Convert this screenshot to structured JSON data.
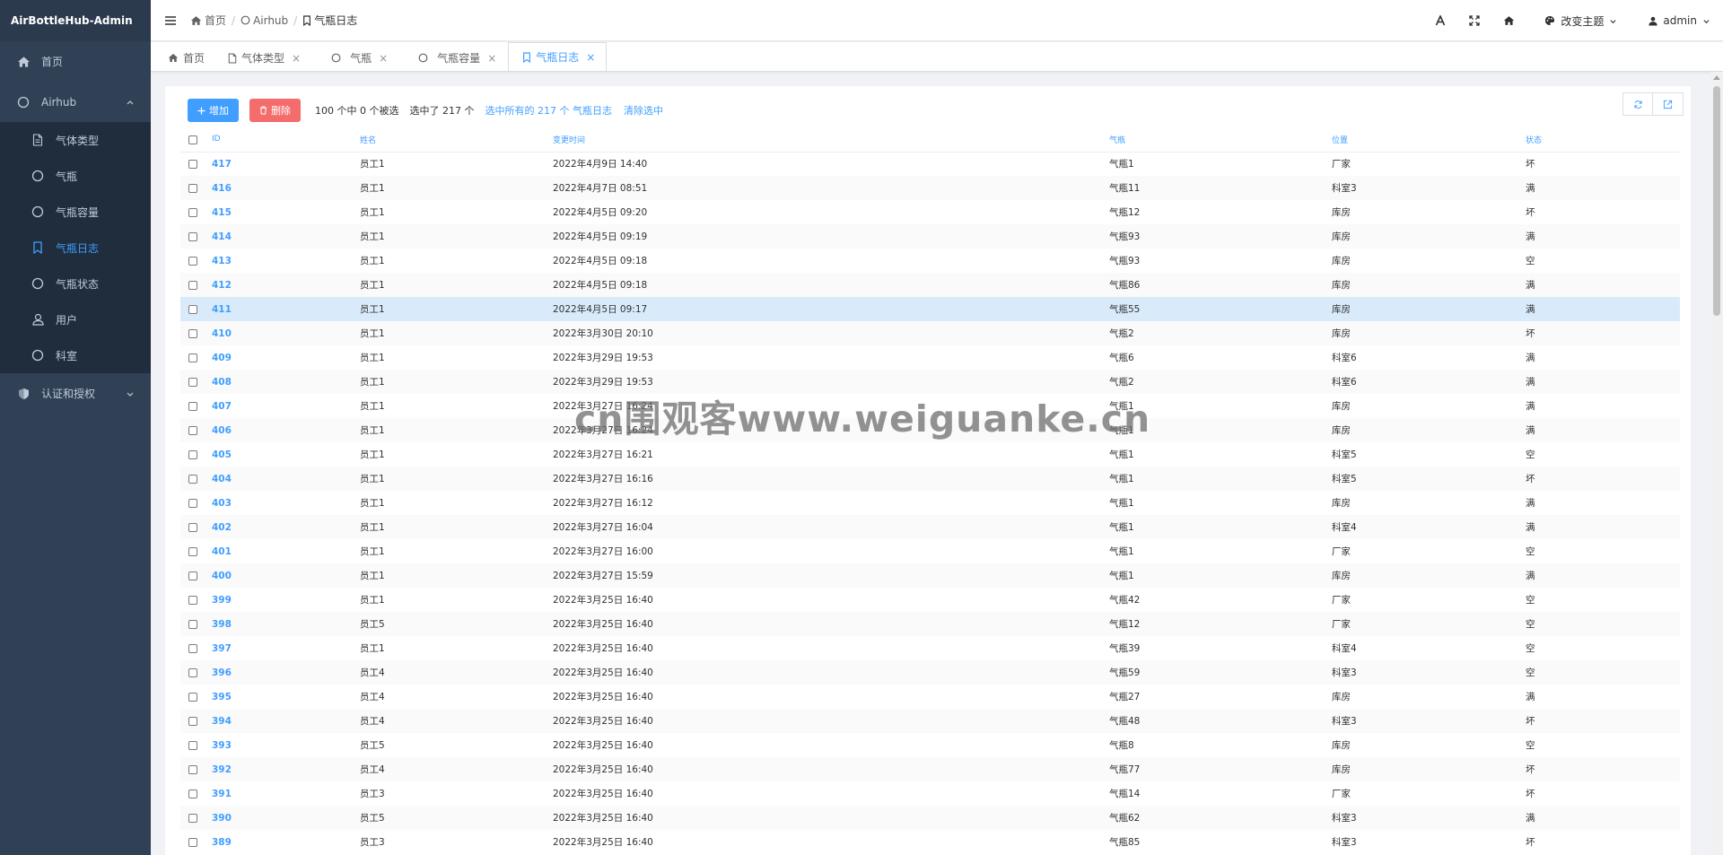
{
  "app": {
    "title": "AirBottleHub-Admin"
  },
  "sidebar": {
    "home": {
      "label": "首页",
      "icon": "home-icon"
    },
    "airhub": {
      "label": "Airhub",
      "icon": "circle-icon",
      "items": [
        {
          "label": "气体类型",
          "icon": "document-icon"
        },
        {
          "label": "气瓶",
          "icon": "circle-icon"
        },
        {
          "label": "气瓶容量",
          "icon": "circle-icon"
        },
        {
          "label": "气瓶日志",
          "icon": "bookmark-icon",
          "active": true
        },
        {
          "label": "气瓶状态",
          "icon": "circle-icon"
        },
        {
          "label": "用户",
          "icon": "user-icon"
        },
        {
          "label": "科室",
          "icon": "circle-icon"
        }
      ]
    },
    "auth": {
      "label": "认证和授权",
      "icon": "shield-icon"
    }
  },
  "header": {
    "breadcrumb": [
      "首页",
      "Airhub",
      "气瓶日志"
    ],
    "theme_label": "改变主题",
    "user": "admin"
  },
  "tabs": [
    {
      "label": "首页",
      "icon": "home-icon",
      "closable": false
    },
    {
      "label": "气体类型",
      "icon": "document-icon",
      "closable": true
    },
    {
      "label": "气瓶",
      "icon": "circle-icon",
      "closable": true
    },
    {
      "label": "气瓶容量",
      "icon": "circle-icon",
      "closable": true
    },
    {
      "label": "气瓶日志",
      "icon": "bookmark-icon",
      "closable": true,
      "active": true
    }
  ],
  "toolbar": {
    "add_label": "增加",
    "delete_label": "删除",
    "selection_count": "100 个中 0 个被选",
    "selected_total": "选中了 217 个",
    "select_all_link": "选中所有的 217 个 气瓶日志",
    "clear_link": "清除选中"
  },
  "table": {
    "columns": [
      "ID",
      "姓名",
      "变更时间",
      "气瓶",
      "位置",
      "状态"
    ],
    "rows": [
      [
        "417",
        "员工1",
        "2022年4月9日 14:40",
        "气瓶1",
        "厂家",
        "坏"
      ],
      [
        "416",
        "员工1",
        "2022年4月7日 08:51",
        "气瓶11",
        "科室3",
        "满"
      ],
      [
        "415",
        "员工1",
        "2022年4月5日 09:20",
        "气瓶12",
        "库房",
        "坏"
      ],
      [
        "414",
        "员工1",
        "2022年4月5日 09:19",
        "气瓶93",
        "库房",
        "满"
      ],
      [
        "413",
        "员工1",
        "2022年4月5日 09:18",
        "气瓶93",
        "库房",
        "空"
      ],
      [
        "412",
        "员工1",
        "2022年4月5日 09:18",
        "气瓶86",
        "库房",
        "满"
      ],
      [
        "411",
        "员工1",
        "2022年4月5日 09:17",
        "气瓶55",
        "库房",
        "满"
      ],
      [
        "410",
        "员工1",
        "2022年3月30日 20:10",
        "气瓶2",
        "库房",
        "坏"
      ],
      [
        "409",
        "员工1",
        "2022年3月29日 19:53",
        "气瓶6",
        "科室6",
        "满"
      ],
      [
        "408",
        "员工1",
        "2022年3月29日 19:53",
        "气瓶2",
        "科室6",
        "满"
      ],
      [
        "407",
        "员工1",
        "2022年3月27日 16:24",
        "气瓶1",
        "库房",
        "满"
      ],
      [
        "406",
        "员工1",
        "2022年3月27日 16:24",
        "气瓶1",
        "库房",
        "满"
      ],
      [
        "405",
        "员工1",
        "2022年3月27日 16:21",
        "气瓶1",
        "科室5",
        "空"
      ],
      [
        "404",
        "员工1",
        "2022年3月27日 16:16",
        "气瓶1",
        "科室5",
        "坏"
      ],
      [
        "403",
        "员工1",
        "2022年3月27日 16:12",
        "气瓶1",
        "库房",
        "满"
      ],
      [
        "402",
        "员工1",
        "2022年3月27日 16:04",
        "气瓶1",
        "科室4",
        "满"
      ],
      [
        "401",
        "员工1",
        "2022年3月27日 16:00",
        "气瓶1",
        "厂家",
        "空"
      ],
      [
        "400",
        "员工1",
        "2022年3月27日 15:59",
        "气瓶1",
        "库房",
        "满"
      ],
      [
        "399",
        "员工1",
        "2022年3月25日 16:40",
        "气瓶42",
        "厂家",
        "空"
      ],
      [
        "398",
        "员工5",
        "2022年3月25日 16:40",
        "气瓶12",
        "厂家",
        "空"
      ],
      [
        "397",
        "员工1",
        "2022年3月25日 16:40",
        "气瓶39",
        "科室4",
        "空"
      ],
      [
        "396",
        "员工4",
        "2022年3月25日 16:40",
        "气瓶59",
        "科室3",
        "空"
      ],
      [
        "395",
        "员工4",
        "2022年3月25日 16:40",
        "气瓶27",
        "库房",
        "满"
      ],
      [
        "394",
        "员工4",
        "2022年3月25日 16:40",
        "气瓶48",
        "科室3",
        "坏"
      ],
      [
        "393",
        "员工5",
        "2022年3月25日 16:40",
        "气瓶8",
        "库房",
        "空"
      ],
      [
        "392",
        "员工4",
        "2022年3月25日 16:40",
        "气瓶77",
        "库房",
        "坏"
      ],
      [
        "391",
        "员工3",
        "2022年3月25日 16:40",
        "气瓶14",
        "厂家",
        "坏"
      ],
      [
        "390",
        "员工5",
        "2022年3月25日 16:40",
        "气瓶62",
        "科室3",
        "满"
      ],
      [
        "389",
        "员工3",
        "2022年3月25日 16:40",
        "气瓶85",
        "科室3",
        "坏"
      ]
    ],
    "highlight_row_id": "411"
  },
  "watermark": "cn围观客www.weiguanke.cn",
  "colors": {
    "sidebar_bg": "#304156",
    "submenu_bg": "#1f2d3d",
    "accent": "#409eff",
    "danger": "#f56c6c"
  }
}
